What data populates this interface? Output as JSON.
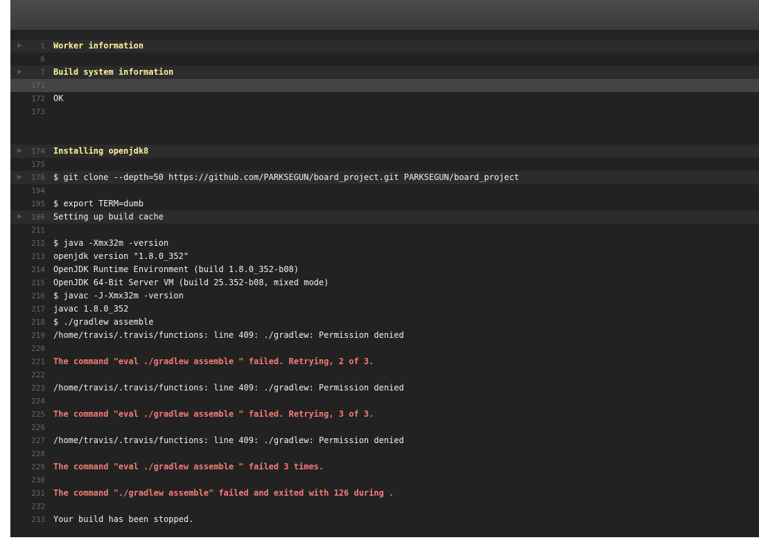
{
  "log": {
    "lines": [
      {
        "num": "1",
        "text": "Worker information",
        "style": "yellow",
        "fold": true
      },
      {
        "num": "6",
        "text": ""
      },
      {
        "num": "7",
        "text": "Build system information",
        "style": "yellow",
        "fold": true
      },
      {
        "num": "171",
        "text": "",
        "highlight": true
      },
      {
        "num": "172",
        "text": "OK"
      },
      {
        "num": "173",
        "text": ""
      },
      {
        "gap": true
      },
      {
        "gap": true
      },
      {
        "num": "174",
        "text": "Installing openjdk8",
        "style": "yellow",
        "fold": true
      },
      {
        "num": "175",
        "text": ""
      },
      {
        "num": "176",
        "text": "$ git clone --depth=50 https://github.com/PARKSEGUN/board_project.git PARKSEGUN/board_project",
        "fold": true
      },
      {
        "num": "194",
        "text": ""
      },
      {
        "num": "195",
        "text": "$ export TERM=dumb"
      },
      {
        "num": "196",
        "text": "Setting up build cache",
        "fold": true
      },
      {
        "num": "211",
        "text": ""
      },
      {
        "num": "212",
        "text": "$ java -Xmx32m -version"
      },
      {
        "num": "213",
        "text": "openjdk version \"1.8.0_352\""
      },
      {
        "num": "214",
        "text": "OpenJDK Runtime Environment (build 1.8.0_352-b08)"
      },
      {
        "num": "215",
        "text": "OpenJDK 64-Bit Server VM (build 25.352-b08, mixed mode)"
      },
      {
        "num": "216",
        "text": "$ javac -J-Xmx32m -version"
      },
      {
        "num": "217",
        "text": "javac 1.8.0_352"
      },
      {
        "num": "218",
        "text": "$ ./gradlew assemble"
      },
      {
        "num": "219",
        "text": "/home/travis/.travis/functions: line 409: ./gradlew: Permission denied"
      },
      {
        "num": "220",
        "text": ""
      },
      {
        "num": "221",
        "text": "The command \"eval ./gradlew assemble \" failed. Retrying, 2 of 3.",
        "style": "red"
      },
      {
        "num": "222",
        "text": ""
      },
      {
        "num": "223",
        "text": "/home/travis/.travis/functions: line 409: ./gradlew: Permission denied"
      },
      {
        "num": "224",
        "text": ""
      },
      {
        "num": "225",
        "text": "The command \"eval ./gradlew assemble \" failed. Retrying, 3 of 3.",
        "style": "red"
      },
      {
        "num": "226",
        "text": ""
      },
      {
        "num": "227",
        "text": "/home/travis/.travis/functions: line 409: ./gradlew: Permission denied"
      },
      {
        "num": "228",
        "text": ""
      },
      {
        "num": "229",
        "text": "The command \"eval ./gradlew assemble \" failed 3 times.",
        "style": "red"
      },
      {
        "num": "230",
        "text": ""
      },
      {
        "num": "231",
        "text": "The command \"./gradlew assemble\" failed and exited with 126 during .",
        "style": "red"
      },
      {
        "num": "232",
        "text": ""
      },
      {
        "num": "233",
        "text": "Your build has been stopped."
      }
    ]
  },
  "colors": {
    "panel_bg": "#222222",
    "header_bg": "#454545",
    "fold_bg": "#2c2c2c",
    "highlight_bg": "#444444",
    "yellow_text": "#fcf49c",
    "red_text": "#f67b76",
    "line_number": "#666666"
  },
  "icons": {
    "fold": "fold-arrow-icon"
  }
}
